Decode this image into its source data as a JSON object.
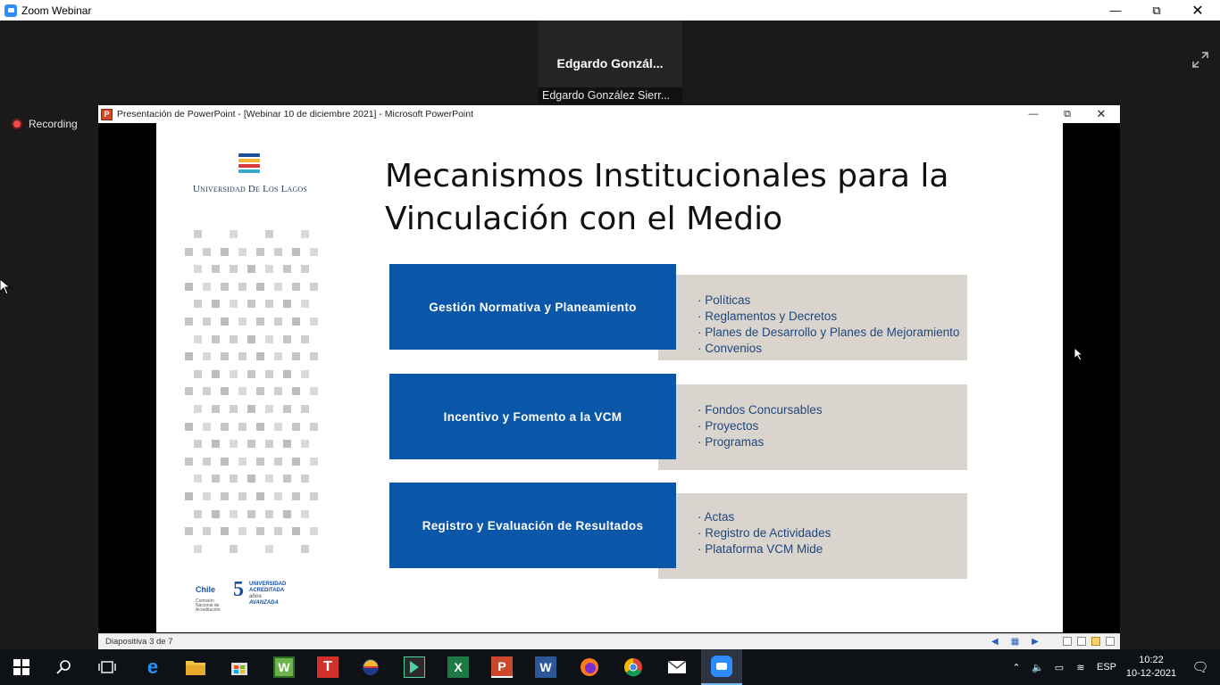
{
  "zoom": {
    "window_title": "Zoom Webinar",
    "recording_label": "Recording",
    "participant_name_short": "Edgardo  Gonzál...",
    "participant_name_full": "Edgardo González Sierr..."
  },
  "ppt": {
    "window_title": "Presentación de PowerPoint - [Webinar 10 de diciembre 2021] - Microsoft PowerPoint",
    "icon_letter": "P",
    "slide_counter": "Diapositiva 3 de 7"
  },
  "slide": {
    "university_name": "Universidad De Los Lagos",
    "title": "Mecanismos Institucionales para la Vinculación con el Medio",
    "rows": [
      {
        "heading": "Gestión Normativa y Planeamiento",
        "items": [
          "Políticas",
          "Reglamentos y Decretos",
          "Planes de Desarrollo y Planes de Mejoramiento",
          "Convenios"
        ]
      },
      {
        "heading": "Incentivo y Fomento a la VCM",
        "items": [
          "Fondos Concursables",
          "Proyectos",
          "Programas"
        ]
      },
      {
        "heading": "Registro y Evaluación de Resultados",
        "items": [
          "Actas",
          "Registro de Actividades",
          "Plataforma VCM Mide"
        ]
      }
    ],
    "accreditation": {
      "agency": "Chile",
      "agency_sub": "Comisión Nacional de Acreditación",
      "years": "5",
      "years_label": "años",
      "status": "UNIVERSIDAD ACREDITADA",
      "level": "AVANZADA"
    }
  },
  "taskbar": {
    "language": "ESP",
    "time": "10:22",
    "date": "10-12-2021"
  },
  "colors": {
    "slide_blue": "#0a56a8",
    "slide_gray": "#d9d4ce",
    "recording_red": "#f24a4a",
    "zoom_blue": "#2d8cff"
  }
}
